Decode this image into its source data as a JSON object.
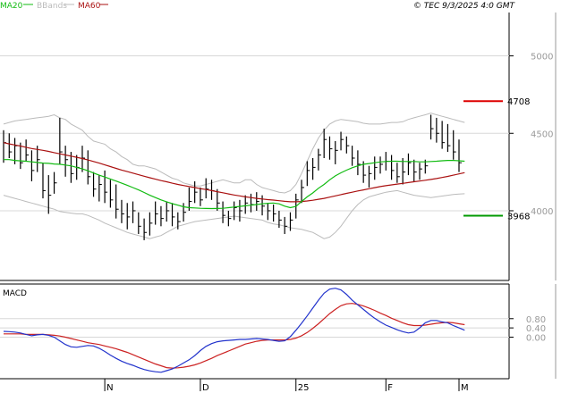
{
  "legend": {
    "ma20": "MA20",
    "bbands": "BBands",
    "ma60": "MA60",
    "copyright": "© TEC 9/3/2025 4:0 GMT"
  },
  "colors": {
    "ma20": "#11bb11",
    "ma60": "#aa1111",
    "bbands": "#bbbbbb",
    "price_bars": "#000000",
    "resistance": "#dd0000",
    "support": "#009900",
    "macd_line": "#2233cc",
    "macd_signal": "#cc2222",
    "grid": "#d8d8d8"
  },
  "chart_data": [
    {
      "type": "ohlc",
      "panel": "price",
      "y_ticks": [
        "5000",
        "4500",
        "4000"
      ],
      "y_tick_values": [
        5000,
        4500,
        4000
      ],
      "ylim": [
        3550,
        5280
      ],
      "x_labels": [
        "N",
        "D",
        "25",
        "F",
        "M"
      ],
      "bars": [
        {
          "h": 4520,
          "l": 4310,
          "c": 4440
        },
        {
          "h": 4500,
          "l": 4340,
          "c": 4380
        },
        {
          "h": 4470,
          "l": 4300,
          "c": 4420
        },
        {
          "h": 4440,
          "l": 4270,
          "c": 4310
        },
        {
          "h": 4460,
          "l": 4320,
          "c": 4360
        },
        {
          "h": 4390,
          "l": 4190,
          "c": 4260
        },
        {
          "h": 4420,
          "l": 4250,
          "c": 4330
        },
        {
          "h": 4310,
          "l": 4080,
          "c": 4130
        },
        {
          "h": 4230,
          "l": 3980,
          "c": 4100
        },
        {
          "h": 4250,
          "l": 4110,
          "c": 4180
        },
        {
          "h": 4600,
          "l": 4300,
          "c": 4380
        },
        {
          "h": 4420,
          "l": 4220,
          "c": 4330
        },
        {
          "h": 4380,
          "l": 4180,
          "c": 4240
        },
        {
          "h": 4360,
          "l": 4200,
          "c": 4280
        },
        {
          "h": 4420,
          "l": 4250,
          "c": 4340
        },
        {
          "h": 4390,
          "l": 4170,
          "c": 4220
        },
        {
          "h": 4250,
          "l": 4090,
          "c": 4140
        },
        {
          "h": 4230,
          "l": 4060,
          "c": 4170
        },
        {
          "h": 4260,
          "l": 4050,
          "c": 4120
        },
        {
          "h": 4200,
          "l": 4020,
          "c": 4070
        },
        {
          "h": 4170,
          "l": 3950,
          "c": 4010
        },
        {
          "h": 4070,
          "l": 3920,
          "c": 3980
        },
        {
          "h": 4050,
          "l": 3880,
          "c": 3960
        },
        {
          "h": 4060,
          "l": 3920,
          "c": 4000
        },
        {
          "h": 3990,
          "l": 3850,
          "c": 3900
        },
        {
          "h": 3950,
          "l": 3810,
          "c": 3860
        },
        {
          "h": 3990,
          "l": 3840,
          "c": 3920
        },
        {
          "h": 4060,
          "l": 3910,
          "c": 3980
        },
        {
          "h": 4030,
          "l": 3900,
          "c": 3950
        },
        {
          "h": 4060,
          "l": 3930,
          "c": 4000
        },
        {
          "h": 4050,
          "l": 3900,
          "c": 3960
        },
        {
          "h": 3990,
          "l": 3880,
          "c": 3930
        },
        {
          "h": 4050,
          "l": 3930,
          "c": 3990
        },
        {
          "h": 4150,
          "l": 4000,
          "c": 4060
        },
        {
          "h": 4190,
          "l": 4050,
          "c": 4120
        },
        {
          "h": 4150,
          "l": 4030,
          "c": 4070
        },
        {
          "h": 4210,
          "l": 4080,
          "c": 4140
        },
        {
          "h": 4200,
          "l": 4070,
          "c": 4130
        },
        {
          "h": 4140,
          "l": 4000,
          "c": 4050
        },
        {
          "h": 4060,
          "l": 3920,
          "c": 3970
        },
        {
          "h": 4000,
          "l": 3900,
          "c": 3950
        },
        {
          "h": 4060,
          "l": 3940,
          "c": 4020
        },
        {
          "h": 4070,
          "l": 3930,
          "c": 4000
        },
        {
          "h": 4100,
          "l": 3980,
          "c": 4050
        },
        {
          "h": 4110,
          "l": 3990,
          "c": 4040
        },
        {
          "h": 4120,
          "l": 4000,
          "c": 4060
        },
        {
          "h": 4100,
          "l": 3970,
          "c": 4030
        },
        {
          "h": 4050,
          "l": 3940,
          "c": 4000
        },
        {
          "h": 4040,
          "l": 3930,
          "c": 3980
        },
        {
          "h": 4000,
          "l": 3890,
          "c": 3940
        },
        {
          "h": 3960,
          "l": 3850,
          "c": 3900
        },
        {
          "h": 3990,
          "l": 3870,
          "c": 3940
        },
        {
          "h": 4110,
          "l": 3950,
          "c": 4070
        },
        {
          "h": 4200,
          "l": 4050,
          "c": 4150
        },
        {
          "h": 4320,
          "l": 4160,
          "c": 4260
        },
        {
          "h": 4340,
          "l": 4200,
          "c": 4280
        },
        {
          "h": 4400,
          "l": 4260,
          "c": 4360
        },
        {
          "h": 4530,
          "l": 4340,
          "c": 4460
        },
        {
          "h": 4480,
          "l": 4330,
          "c": 4400
        },
        {
          "h": 4450,
          "l": 4300,
          "c": 4390
        },
        {
          "h": 4510,
          "l": 4390,
          "c": 4460
        },
        {
          "h": 4480,
          "l": 4370,
          "c": 4420
        },
        {
          "h": 4420,
          "l": 4290,
          "c": 4340
        },
        {
          "h": 4390,
          "l": 4230,
          "c": 4300
        },
        {
          "h": 4320,
          "l": 4180,
          "c": 4230
        },
        {
          "h": 4290,
          "l": 4150,
          "c": 4240
        },
        {
          "h": 4350,
          "l": 4200,
          "c": 4280
        },
        {
          "h": 4350,
          "l": 4240,
          "c": 4300
        },
        {
          "h": 4380,
          "l": 4260,
          "c": 4320
        },
        {
          "h": 4360,
          "l": 4200,
          "c": 4260
        },
        {
          "h": 4310,
          "l": 4180,
          "c": 4220
        },
        {
          "h": 4340,
          "l": 4170,
          "c": 4250
        },
        {
          "h": 4370,
          "l": 4230,
          "c": 4310
        },
        {
          "h": 4330,
          "l": 4190,
          "c": 4250
        },
        {
          "h": 4310,
          "l": 4200,
          "c": 4270
        },
        {
          "h": 4330,
          "l": 4240,
          "c": 4290
        },
        {
          "h": 4620,
          "l": 4460,
          "c": 4530
        },
        {
          "h": 4600,
          "l": 4440,
          "c": 4500
        },
        {
          "h": 4580,
          "l": 4400,
          "c": 4440
        },
        {
          "h": 4560,
          "l": 4380,
          "c": 4420
        },
        {
          "h": 4520,
          "l": 4330,
          "c": 4380
        },
        {
          "h": 4460,
          "l": 4250,
          "c": 4310
        }
      ],
      "series": [
        {
          "name": "MA20",
          "values": [
            4330,
            4330,
            4325,
            4322,
            4320,
            4316,
            4312,
            4308,
            4306,
            4302,
            4300,
            4295,
            4290,
            4280,
            4270,
            4258,
            4244,
            4230,
            4218,
            4205,
            4192,
            4178,
            4165,
            4150,
            4135,
            4118,
            4100,
            4085,
            4070,
            4058,
            4046,
            4036,
            4026,
            4020,
            4018,
            4016,
            4015,
            4014,
            4015,
            4016,
            4020,
            4024,
            4028,
            4032,
            4036,
            4040,
            4045,
            4048,
            4050,
            4045,
            4030,
            4020,
            4028,
            4060,
            4090,
            4115,
            4145,
            4170,
            4200,
            4225,
            4245,
            4262,
            4278,
            4290,
            4300,
            4305,
            4310,
            4315,
            4318,
            4320,
            4320,
            4318,
            4318,
            4318,
            4316,
            4316,
            4318,
            4320,
            4323,
            4325,
            4325,
            4323,
            4320
          ]
        },
        {
          "name": "MA60",
          "values": [
            4440,
            4432,
            4425,
            4418,
            4410,
            4402,
            4396,
            4390,
            4383,
            4375,
            4368,
            4360,
            4353,
            4345,
            4337,
            4328,
            4318,
            4308,
            4296,
            4285,
            4274,
            4263,
            4253,
            4243,
            4233,
            4223,
            4213,
            4204,
            4195,
            4187,
            4178,
            4170,
            4163,
            4156,
            4150,
            4143,
            4137,
            4130,
            4123,
            4116,
            4109,
            4102,
            4096,
            4090,
            4085,
            4080,
            4076,
            4072,
            4069,
            4065,
            4061,
            4058,
            4058,
            4060,
            4063,
            4068,
            4074,
            4080,
            4088,
            4096,
            4104,
            4112,
            4120,
            4128,
            4135,
            4142,
            4149,
            4156,
            4162,
            4167,
            4172,
            4177,
            4182,
            4187,
            4192,
            4197,
            4202,
            4208,
            4215,
            4222,
            4230,
            4238,
            4246
          ]
        },
        {
          "name": "BBands upper",
          "values": [
            4560,
            4570,
            4580,
            4585,
            4590,
            4595,
            4600,
            4605,
            4610,
            4620,
            4600,
            4590,
            4560,
            4540,
            4520,
            4480,
            4450,
            4440,
            4430,
            4400,
            4380,
            4350,
            4330,
            4300,
            4290,
            4290,
            4280,
            4270,
            4250,
            4230,
            4210,
            4200,
            4180,
            4170,
            4160,
            4160,
            4170,
            4180,
            4190,
            4200,
            4190,
            4180,
            4180,
            4200,
            4200,
            4170,
            4150,
            4140,
            4130,
            4120,
            4115,
            4130,
            4170,
            4240,
            4320,
            4400,
            4470,
            4520,
            4560,
            4580,
            4590,
            4585,
            4580,
            4575,
            4565,
            4560,
            4560,
            4560,
            4565,
            4570,
            4570,
            4575,
            4590,
            4600,
            4610,
            4620,
            4630,
            4620,
            4610,
            4600,
            4590,
            4580,
            4570
          ]
        },
        {
          "name": "BBands lower",
          "values": [
            4100,
            4090,
            4080,
            4070,
            4060,
            4050,
            4040,
            4030,
            4020,
            4010,
            3995,
            3990,
            3985,
            3980,
            3980,
            3970,
            3955,
            3940,
            3920,
            3905,
            3890,
            3875,
            3860,
            3850,
            3840,
            3830,
            3820,
            3830,
            3840,
            3860,
            3880,
            3900,
            3910,
            3920,
            3930,
            3935,
            3940,
            3945,
            3950,
            3955,
            3960,
            3965,
            3960,
            3955,
            3950,
            3945,
            3940,
            3925,
            3915,
            3910,
            3900,
            3890,
            3885,
            3880,
            3870,
            3860,
            3840,
            3820,
            3830,
            3860,
            3900,
            3950,
            4000,
            4040,
            4070,
            4090,
            4100,
            4110,
            4120,
            4125,
            4130,
            4120,
            4110,
            4100,
            4095,
            4090,
            4085,
            4090,
            4095,
            4100,
            4105,
            4108,
            4110
          ]
        }
      ],
      "levels": [
        {
          "name": "resistance",
          "value": "4708"
        },
        {
          "name": "support",
          "value": "3968"
        }
      ]
    },
    {
      "type": "line",
      "panel": "macd",
      "title": "MACD",
      "y_ticks": [
        "0.80",
        "0.40",
        "0.00"
      ],
      "y_tick_values": [
        80,
        40,
        0
      ],
      "ylim": [
        -180,
        230
      ],
      "series": [
        {
          "name": "MACD",
          "values": [
            25,
            24,
            22,
            18,
            12,
            6,
            10,
            12,
            8,
            0,
            -16,
            -32,
            -42,
            -44,
            -40,
            -36,
            -38,
            -48,
            -62,
            -78,
            -92,
            -104,
            -114,
            -122,
            -132,
            -140,
            -146,
            -150,
            -152,
            -145,
            -138,
            -126,
            -112,
            -98,
            -80,
            -58,
            -40,
            -28,
            -20,
            -16,
            -14,
            -12,
            -10,
            -10,
            -8,
            -6,
            -8,
            -10,
            -14,
            -18,
            -16,
            2,
            30,
            60,
            92,
            126,
            160,
            190,
            208,
            212,
            205,
            185,
            160,
            140,
            120,
            100,
            82,
            66,
            52,
            42,
            32,
            24,
            18,
            22,
            40,
            62,
            72,
            72,
            66,
            62,
            50,
            40,
            30
          ]
        },
        {
          "name": "Signal",
          "values": [
            14,
            14,
            14,
            14,
            12,
            12,
            12,
            12,
            10,
            8,
            5,
            0,
            -6,
            -12,
            -18,
            -24,
            -28,
            -32,
            -38,
            -44,
            -50,
            -58,
            -66,
            -76,
            -86,
            -96,
            -106,
            -116,
            -124,
            -132,
            -134,
            -133,
            -130,
            -126,
            -120,
            -112,
            -102,
            -92,
            -80,
            -70,
            -60,
            -50,
            -40,
            -30,
            -24,
            -18,
            -14,
            -12,
            -12,
            -12,
            -12,
            -10,
            -4,
            6,
            20,
            38,
            58,
            80,
            102,
            120,
            136,
            144,
            146,
            142,
            135,
            126,
            116,
            104,
            94,
            82,
            72,
            62,
            54,
            50,
            50,
            52,
            56,
            60,
            62,
            64,
            62,
            58,
            54
          ]
        }
      ]
    }
  ]
}
